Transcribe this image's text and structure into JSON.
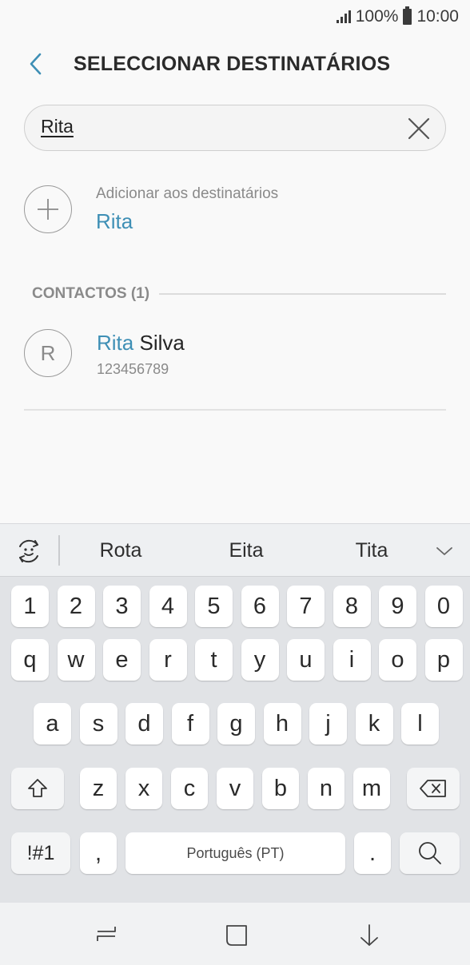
{
  "status_bar": {
    "battery": "100%",
    "time": "10:00"
  },
  "header": {
    "title": "SELECCIONAR DESTINATÁRIOS"
  },
  "search": {
    "value": "Rita"
  },
  "add_recipient": {
    "label": "Adicionar aos destinatários",
    "name": "Rita"
  },
  "contacts_section": {
    "label": "CONTACTOS (1)"
  },
  "contacts": [
    {
      "highlight": "Rita",
      "rest": " Silva",
      "initial": "R",
      "number": "123456789"
    }
  ],
  "keyboard": {
    "suggestions": [
      "Rota",
      "Eita",
      "Tita"
    ],
    "row_numbers": [
      "1",
      "2",
      "3",
      "4",
      "5",
      "6",
      "7",
      "8",
      "9",
      "0"
    ],
    "row_top": [
      "q",
      "w",
      "e",
      "r",
      "t",
      "y",
      "u",
      "i",
      "o",
      "p"
    ],
    "row_middle": [
      "a",
      "s",
      "d",
      "f",
      "g",
      "h",
      "j",
      "k",
      "l"
    ],
    "row_bottom": [
      "z",
      "x",
      "c",
      "v",
      "b",
      "n",
      "m"
    ],
    "symbols_label": "!#1",
    "comma_label": ",",
    "space_label": "Português (PT)",
    "period_label": "."
  },
  "colors": {
    "accent": "#3e8fb5",
    "keyboard_bg": "#e1e3e6"
  }
}
